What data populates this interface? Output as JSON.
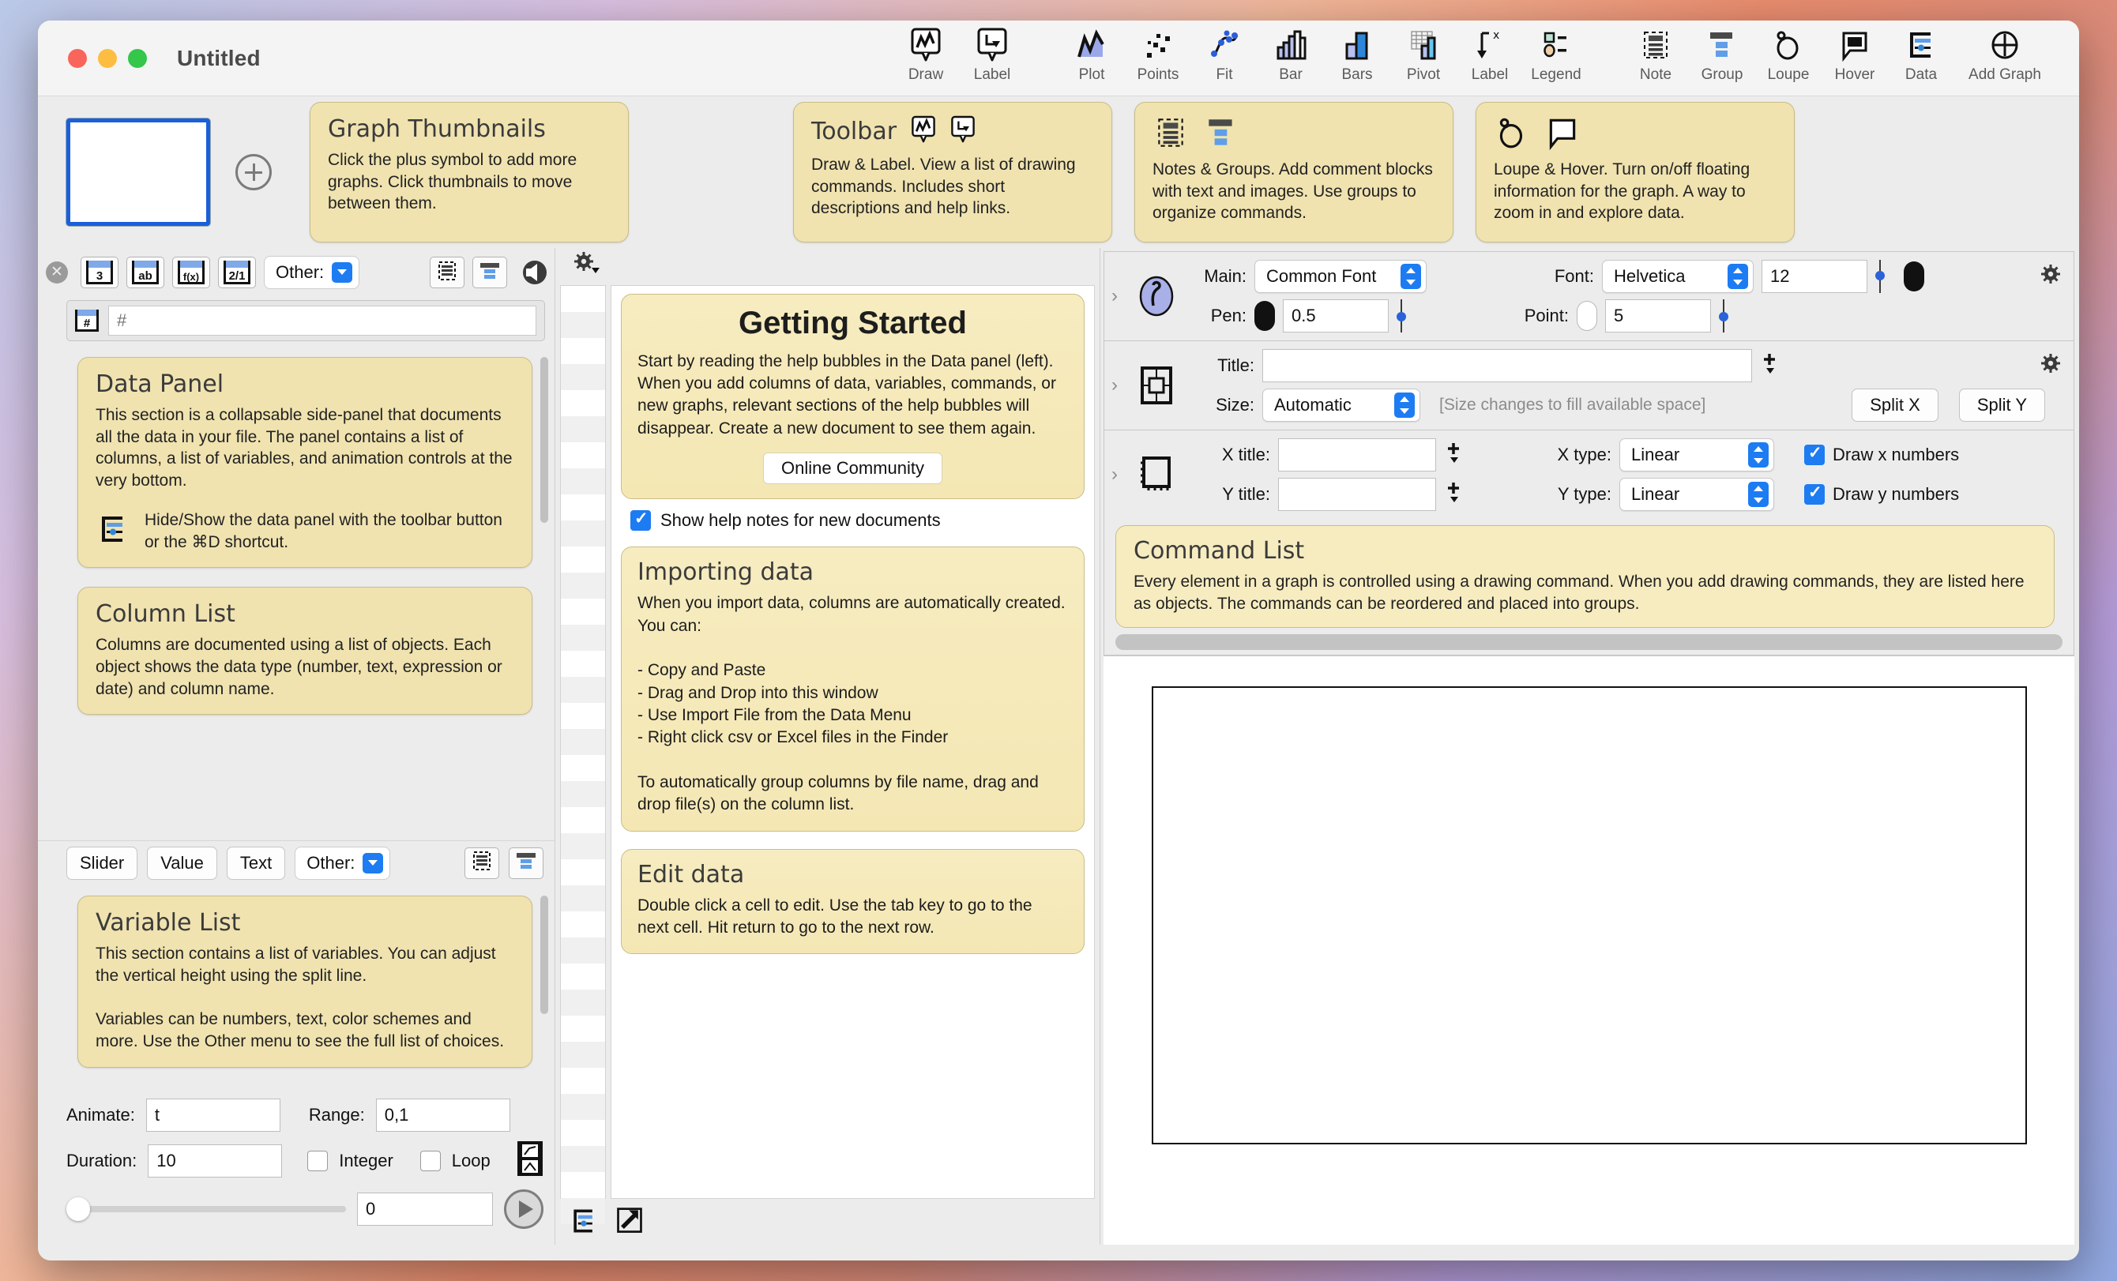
{
  "window": {
    "title": "Untitled"
  },
  "toolbar": {
    "items": [
      {
        "label": "Draw",
        "icon": "draw-callout-icon"
      },
      {
        "label": "Label",
        "icon": "label-callout-icon"
      },
      {
        "label": "Plot",
        "icon": "plot-area-icon"
      },
      {
        "label": "Points",
        "icon": "points-scatter-icon"
      },
      {
        "label": "Fit",
        "icon": "fit-curve-icon"
      },
      {
        "label": "Bar",
        "icon": "bar-chart-icon"
      },
      {
        "label": "Bars",
        "icon": "bars-chart-icon"
      },
      {
        "label": "Pivot",
        "icon": "pivot-grid-icon"
      },
      {
        "label": "Label",
        "icon": "axis-label-icon"
      },
      {
        "label": "Legend",
        "icon": "legend-icon"
      },
      {
        "label": "Note",
        "icon": "note-icon"
      },
      {
        "label": "Group",
        "icon": "group-icon"
      },
      {
        "label": "Loupe",
        "icon": "loupe-icon"
      },
      {
        "label": "Hover",
        "icon": "hover-callout-icon"
      },
      {
        "label": "Data",
        "icon": "data-panel-icon"
      },
      {
        "label": "Add Graph",
        "icon": "add-graph-plus-icon"
      }
    ]
  },
  "help_strip": {
    "bubbles": [
      {
        "title": "Graph Thumbnails",
        "body": "Click the plus symbol to add more graphs. Click thumbnails to move between them."
      },
      {
        "title": "Toolbar",
        "body": "Draw & Label. View a list of drawing commands. Includes short descriptions and help links."
      },
      {
        "title": "",
        "body": "Notes & Groups. Add comment blocks with text and images. Use groups to organize commands."
      },
      {
        "title": "",
        "body": "Loupe & Hover. Turn on/off floating information for the graph. A way to zoom in and explore data."
      }
    ]
  },
  "data_panel": {
    "column_type_buttons": [
      {
        "glyph": "3",
        "name": "number-column"
      },
      {
        "glyph": "ab",
        "name": "text-column"
      },
      {
        "glyph": "f(x)",
        "name": "expression-column"
      },
      {
        "glyph": "2/1",
        "name": "fraction-column"
      }
    ],
    "other_label": "Other:",
    "search_placeholder": "#",
    "search_value": "",
    "search_glyph": "#",
    "bubbles": [
      {
        "title": "Data Panel",
        "body": "This section is a collapsable side-panel that documents all the data in your file. The panel contains a list of columns, a list of variables, and animation controls at the very bottom.",
        "note": "Hide/Show the data panel with the toolbar button or the ⌘D shortcut."
      },
      {
        "title": "Column List",
        "body": "Columns are documented using a list of objects. Each object shows the data type (number, text, expression or date) and column name."
      },
      {
        "title": "Variable List",
        "body": "This section contains a list of variables. You can adjust the vertical height using the split line.\n\nVariables can be numbers, text, color schemes and more. Use the Other menu to see the full list of choices."
      }
    ],
    "variable_buttons": [
      "Slider",
      "Value",
      "Text"
    ],
    "variable_other_label": "Other:",
    "animation": {
      "animate_label": "Animate:",
      "animate_value": "t",
      "range_label": "Range:",
      "range_value": "0,1",
      "duration_label": "Duration:",
      "duration_value": "10",
      "integer_label": "Integer",
      "integer_checked": false,
      "loop_label": "Loop",
      "loop_checked": false,
      "slider_value": "0",
      "slider_position_pct": 0
    }
  },
  "center": {
    "getting_started": {
      "title": "Getting Started",
      "body": "Start by reading the help bubbles in the Data panel (left).  When you add columns of data, variables, commands, or new graphs, relevant sections of the help bubbles will disappear. Create a new document to see them again.",
      "button": "Online Community"
    },
    "show_help_label": "Show help notes for new documents",
    "show_help_checked": true,
    "notes": [
      {
        "title": "Importing data",
        "body": "When you import data, columns are automatically created. You can:\n\n- Copy and Paste\n- Drag and Drop into this window\n- Use Import File from the Data Menu\n- Right click csv or Excel files in the Finder\n\nTo automatically group columns by file name, drag and drop file(s) on the column list."
      },
      {
        "title": "Edit data",
        "body": "Double click a cell to edit. Use the tab key to go to the next cell. Hit return to go to the next row."
      }
    ]
  },
  "inspector": {
    "main_label": "Main:",
    "main_value": "Common Font",
    "font_label": "Font:",
    "font_value": "Helvetica",
    "font_size": "12",
    "pen_label": "Pen:",
    "pen_value": "0.5",
    "point_label": "Point:",
    "point_value": "5",
    "title_label": "Title:",
    "title_value": "",
    "size_label": "Size:",
    "size_value": "Automatic",
    "size_hint": "[Size changes to fill available space]",
    "split_x": "Split X",
    "split_y": "Split Y",
    "x_title_label": "X title:",
    "x_title_value": "",
    "y_title_label": "Y title:",
    "y_title_value": "",
    "x_type_label": "X type:",
    "x_type_value": "Linear",
    "y_type_label": "Y type:",
    "y_type_value": "Linear",
    "draw_x_numbers_label": "Draw x numbers",
    "draw_x_numbers_checked": true,
    "draw_y_numbers_label": "Draw y numbers",
    "draw_y_numbers_checked": true
  },
  "command_list_help": {
    "title": "Command List",
    "body": "Every element in a graph is controlled using a drawing command. When you add drawing commands, they are listed here as objects. The commands can be reordered and placed into groups."
  },
  "colors": {
    "accent_blue": "#1d7cf2",
    "bubble_bg": "#f0e3b0",
    "note_bg": "#f7ecc0",
    "window_bg": "#ececec",
    "selection_blue": "#1b5fdb"
  }
}
